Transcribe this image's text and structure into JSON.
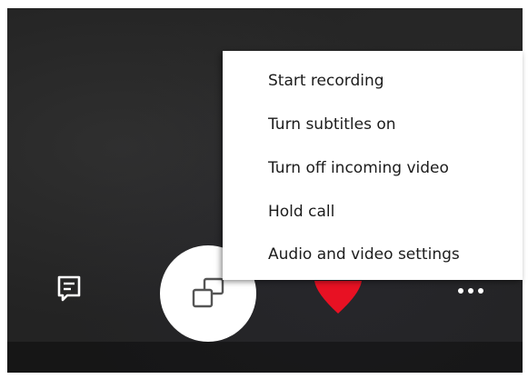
{
  "menu": {
    "items": [
      {
        "label": "Start recording"
      },
      {
        "label": "Turn subtitles on"
      },
      {
        "label": "Turn off incoming video"
      },
      {
        "label": "Hold call"
      },
      {
        "label": "Audio and video settings"
      }
    ]
  },
  "controls": {
    "chat_icon": "chat-icon",
    "switch_icon": "switch-screens-icon",
    "end_call_icon": "end-call-icon",
    "more_icon": "more-options-icon",
    "end_call_color": "#e81123",
    "switch_bg": "#ffffff"
  }
}
